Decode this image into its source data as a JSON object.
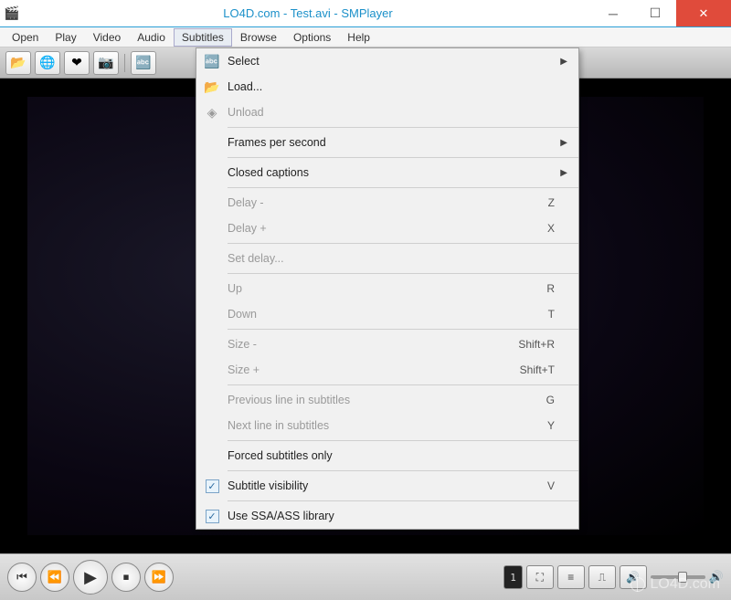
{
  "titlebar": {
    "title": "LO4D.com - Test.avi - SMPlayer"
  },
  "menubar": {
    "items": [
      "Open",
      "Play",
      "Video",
      "Audio",
      "Subtitles",
      "Browse",
      "Options",
      "Help"
    ],
    "active_index": 4
  },
  "toolbar": {
    "icons": [
      "folder-icon",
      "globe-icon",
      "heart-icon",
      "camera-icon",
      "abc-icon"
    ]
  },
  "dropdown": {
    "sections": [
      [
        {
          "icon": "abc-icon",
          "label": "Select",
          "submenu": true
        },
        {
          "icon": "folder-icon",
          "label": "Load..."
        },
        {
          "icon": "disc-icon",
          "label": "Unload",
          "disabled": true
        }
      ],
      [
        {
          "label": "Frames per second",
          "submenu": true
        }
      ],
      [
        {
          "label": "Closed captions",
          "submenu": true
        }
      ],
      [
        {
          "label": "Delay -",
          "shortcut": "Z",
          "disabled": true
        },
        {
          "label": "Delay +",
          "shortcut": "X",
          "disabled": true
        }
      ],
      [
        {
          "label": "Set delay...",
          "disabled": true
        }
      ],
      [
        {
          "label": "Up",
          "shortcut": "R",
          "disabled": true
        },
        {
          "label": "Down",
          "shortcut": "T",
          "disabled": true
        }
      ],
      [
        {
          "label": "Size -",
          "shortcut": "Shift+R",
          "disabled": true
        },
        {
          "label": "Size +",
          "shortcut": "Shift+T",
          "disabled": true
        }
      ],
      [
        {
          "label": "Previous line in subtitles",
          "shortcut": "G",
          "disabled": true
        },
        {
          "label": "Next line in subtitles",
          "shortcut": "Y",
          "disabled": true
        }
      ],
      [
        {
          "label": "Forced subtitles only"
        }
      ],
      [
        {
          "label": "Subtitle visibility",
          "shortcut": "V",
          "checked": true
        }
      ],
      [
        {
          "label": "Use SSA/ASS library",
          "checked": true
        }
      ]
    ]
  },
  "controls": {
    "time": "1"
  },
  "watermark": "LO4D.com"
}
